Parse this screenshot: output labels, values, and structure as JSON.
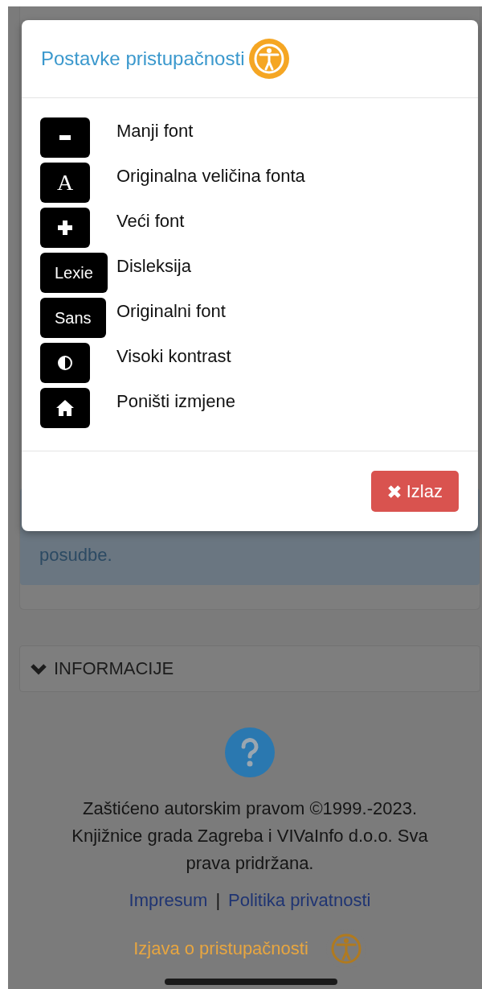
{
  "background": {
    "alert_text": "posudbe.",
    "section": {
      "label": "INFORMACIJE",
      "expanded": false
    },
    "copyright": "Zaštićeno autorskim pravom ©1999.-2023. Knjižnice grada Zagreba i VIVaInfo d.o.o. Sva prava pridržana.",
    "links": [
      "Impresum",
      "Politika privatnosti"
    ],
    "separator": "|",
    "statement_link": "Izjava o pristupačnosti"
  },
  "dialog": {
    "title": "Postavke pristupačnosti",
    "options": [
      {
        "kind": "minus",
        "label": "Manji font"
      },
      {
        "kind": "letter",
        "key": "A",
        "label": "Originalna veličina fonta"
      },
      {
        "kind": "plus",
        "label": "Veći font"
      },
      {
        "kind": "word",
        "key": "Lexie",
        "label": "Disleksija"
      },
      {
        "kind": "word",
        "key": "Sans",
        "label": "Originalni font"
      },
      {
        "kind": "contrast",
        "label": "Visoki kontrast"
      },
      {
        "kind": "home",
        "label": "Poništi izmjene"
      }
    ],
    "close_button": "Izlaz"
  }
}
